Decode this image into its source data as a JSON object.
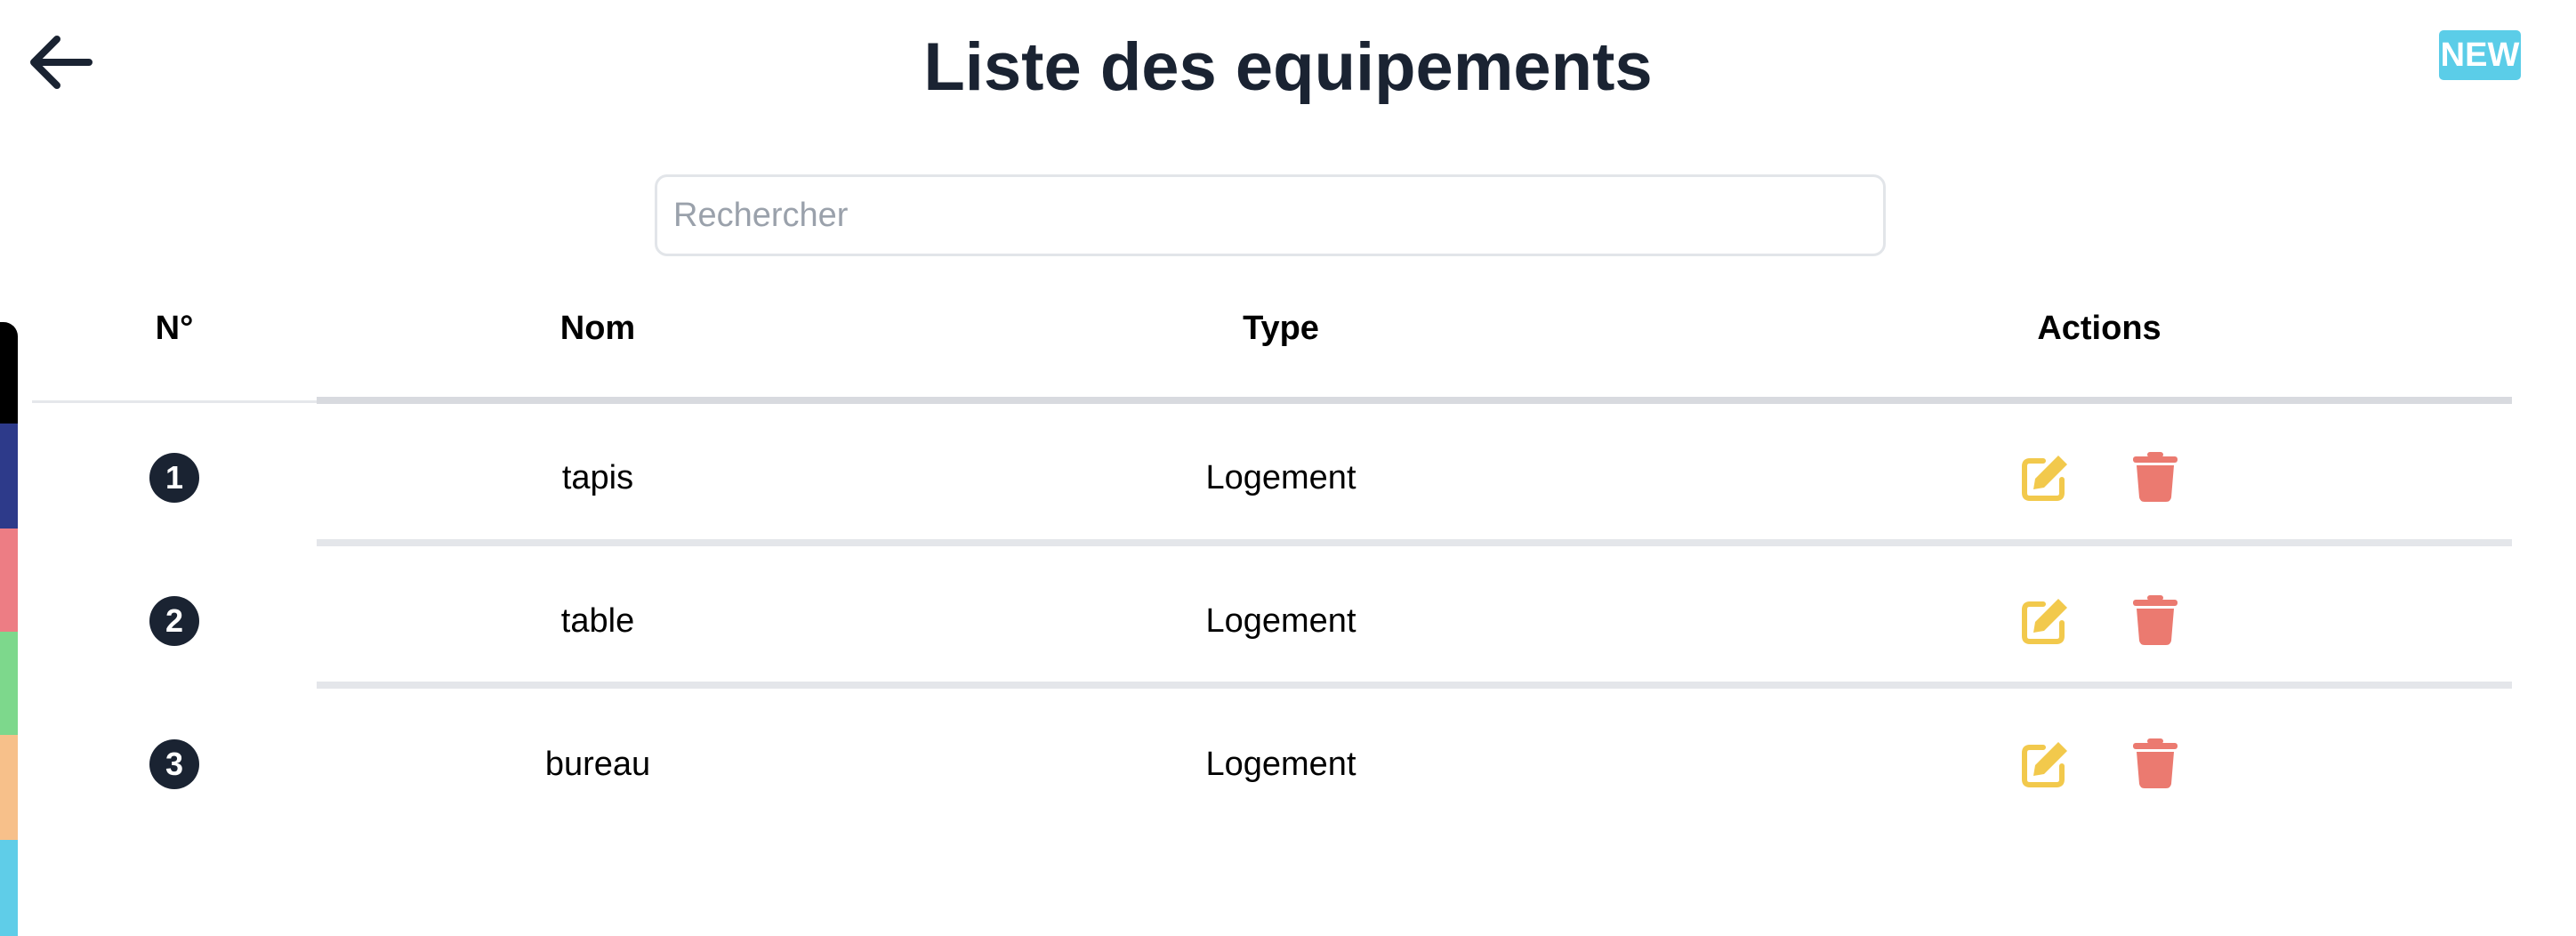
{
  "header": {
    "title": "Liste des equipements",
    "back_icon": "arrow-left-icon",
    "new_label": "NEW",
    "new_color": "#5bcde8"
  },
  "search": {
    "placeholder": "Rechercher",
    "value": ""
  },
  "table": {
    "columns": [
      "N°",
      "Nom",
      "Type",
      "Actions"
    ],
    "rows": [
      {
        "number": "1",
        "nom": "tapis",
        "type": "Logement"
      },
      {
        "number": "2",
        "nom": "table",
        "type": "Logement"
      },
      {
        "number": "3",
        "nom": "bureau",
        "type": "Logement"
      }
    ],
    "action_icons": [
      "edit-icon",
      "trash-icon"
    ]
  },
  "colors": {
    "title": "#1a2332",
    "badge": "#1a2332",
    "edit": "#f2c94c",
    "delete": "#eb7a70",
    "side_strip": [
      "#000000",
      "#2d3a8a",
      "#ed7d84",
      "#7dd88c",
      "#f7c08a",
      "#5fcde8"
    ]
  }
}
